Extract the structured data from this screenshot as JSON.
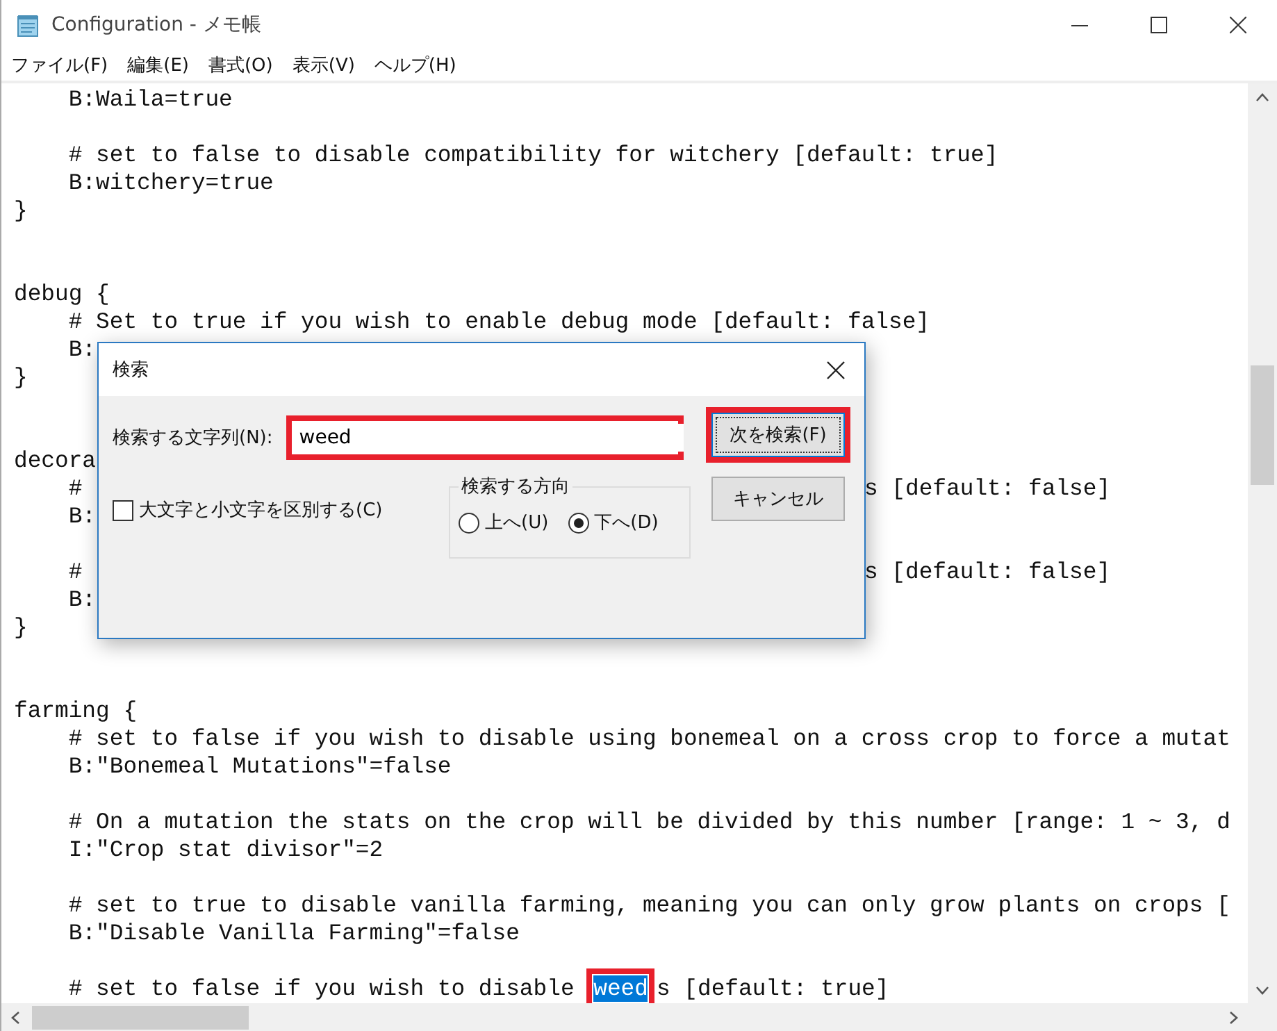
{
  "window": {
    "title": "Configuration - メモ帳"
  },
  "menu": [
    "ファイル(F)",
    "編集(E)",
    "書式(O)",
    "表示(V)",
    "ヘルプ(H)"
  ],
  "lines": [
    {
      "kind": "code",
      "segments": [
        {
          "text": "    B:Waila=true",
          "kind": "plain",
          "selected": false
        }
      ]
    },
    {
      "kind": "blank"
    },
    {
      "kind": "code",
      "segments": [
        {
          "text": "    # set to false to disable compatibility for witchery [default: true]",
          "kind": "plain",
          "selected": false
        }
      ]
    },
    {
      "kind": "code",
      "segments": [
        {
          "text": "    B:witchery=true",
          "kind": "plain",
          "selected": false
        }
      ]
    },
    {
      "kind": "code",
      "segments": [
        {
          "text": "}",
          "kind": "plain",
          "selected": false
        }
      ]
    },
    {
      "kind": "blank"
    },
    {
      "kind": "blank"
    },
    {
      "kind": "code",
      "segments": [
        {
          "text": "debug {",
          "kind": "plain",
          "selected": false
        }
      ]
    },
    {
      "kind": "code",
      "segments": [
        {
          "text": "    # Set to true if you wish to enable debug mode [default: false]",
          "kind": "plain",
          "selected": false
        }
      ]
    },
    {
      "kind": "code",
      "segments": [
        {
          "text": "    B:",
          "kind": "plain",
          "selected": false
        }
      ]
    },
    {
      "kind": "code",
      "segments": [
        {
          "text": "}",
          "kind": "plain",
          "selected": false
        }
      ]
    },
    {
      "kind": "blank"
    },
    {
      "kind": "blank"
    },
    {
      "kind": "code",
      "segments": [
        {
          "text": "decora",
          "kind": "plain",
          "selected": false
        }
      ]
    },
    {
      "kind": "code",
      "segments": [
        {
          "text": "    #",
          "kind": "plain",
          "selected": false
        },
        {
          "text": "s [default: false]",
          "kind": "beside_dialog",
          "selected": false
        }
      ]
    },
    {
      "kind": "code",
      "segments": [
        {
          "text": "    B:",
          "kind": "plain",
          "selected": false
        }
      ]
    },
    {
      "kind": "blank"
    },
    {
      "kind": "code",
      "segments": [
        {
          "text": "    #",
          "kind": "plain",
          "selected": false
        },
        {
          "text": "s [default: false]",
          "kind": "beside_dialog",
          "selected": false
        }
      ]
    },
    {
      "kind": "code",
      "segments": [
        {
          "text": "    B:",
          "kind": "plain",
          "selected": false
        }
      ]
    },
    {
      "kind": "code",
      "segments": [
        {
          "text": "}",
          "kind": "plain",
          "selected": false
        }
      ]
    },
    {
      "kind": "blank"
    },
    {
      "kind": "blank"
    },
    {
      "kind": "code",
      "segments": [
        {
          "text": "farming {",
          "kind": "plain",
          "selected": false
        }
      ]
    },
    {
      "kind": "code",
      "segments": [
        {
          "text": "    # set to false if you wish to disable using bonemeal on a cross crop to force a mutat",
          "kind": "plain",
          "selected": false
        }
      ]
    },
    {
      "kind": "code",
      "segments": [
        {
          "text": "    B:\"Bonemeal Mutations\"=false",
          "kind": "plain",
          "selected": false
        }
      ]
    },
    {
      "kind": "blank"
    },
    {
      "kind": "code",
      "segments": [
        {
          "text": "    # On a mutation the stats on the crop will be divided by this number [range: 1 ~ 3, d",
          "kind": "plain",
          "selected": false
        }
      ]
    },
    {
      "kind": "code",
      "segments": [
        {
          "text": "    I:\"Crop stat divisor\"=2",
          "kind": "plain",
          "selected": false
        }
      ]
    },
    {
      "kind": "blank"
    },
    {
      "kind": "code",
      "segments": [
        {
          "text": "    # set to true to disable vanilla farming, meaning you can only grow plants on crops [",
          "kind": "plain",
          "selected": false
        }
      ]
    },
    {
      "kind": "code",
      "segments": [
        {
          "text": "    B:\"Disable Vanilla Farming\"=false",
          "kind": "plain",
          "selected": false
        }
      ]
    },
    {
      "kind": "blank"
    },
    {
      "kind": "code",
      "segments": [
        {
          "text": "    # set to false if you wish to disable ",
          "kind": "plain",
          "selected": false
        },
        {
          "text": "weed",
          "kind": "plain",
          "selected": true,
          "annotated": true
        },
        {
          "text": "s [default: true]",
          "kind": "plain",
          "selected": false
        }
      ]
    }
  ],
  "find_dialog": {
    "title": "検索",
    "field_label": "検索する文字列(N):",
    "field_value": "weed",
    "field_annotated": true,
    "find_next": {
      "label": "次を検索(F)",
      "annotated": true
    },
    "cancel": {
      "label": "キャンセル",
      "annotated": false
    },
    "match_case": {
      "label": "大文字と小文字を区別する(C)",
      "checked": false
    },
    "direction": {
      "label": "検索する方向",
      "options": [
        {
          "label": "上へ(U)",
          "selected": false
        },
        {
          "label": "下へ(D)",
          "selected": true
        }
      ]
    }
  }
}
